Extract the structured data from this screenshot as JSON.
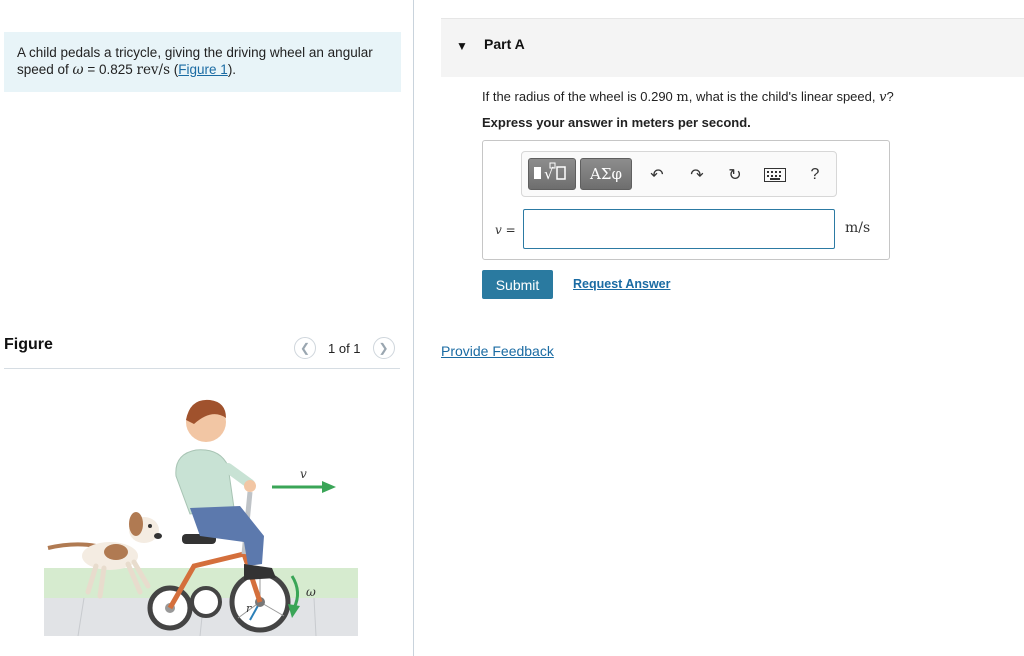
{
  "problem": {
    "text_before": "A child pedals a tricycle, giving the driving wheel an angular speed of ",
    "omega_symbol": "ω",
    "equals": " = 0.825 ",
    "unit": "rev/s",
    "paren_open": " (",
    "figure_link": "Figure 1",
    "paren_close": ")."
  },
  "figure": {
    "title": "Figure",
    "counter": "1 of 1",
    "prev_icon": "chevron-left-icon",
    "next_icon": "chevron-right-icon",
    "labels": {
      "velocity": "v",
      "omega": "ω",
      "radius": "r"
    }
  },
  "part": {
    "title": "Part A",
    "question_prefix": "If the radius of the wheel is 0.290 ",
    "question_unit": "m",
    "question_mid": ", what is the child's linear speed, ",
    "question_var": "v",
    "question_suffix": "?",
    "instruction": "Express your answer in meters per second."
  },
  "toolbar": {
    "templates_icon": "templates-icon",
    "symbols_label": "ΑΣφ",
    "undo_icon": "undo-icon",
    "redo_icon": "redo-icon",
    "reset_icon": "reset-icon",
    "keyboard_icon": "keyboard-icon",
    "help_label": "?"
  },
  "answer": {
    "label_var": "v",
    "label_eq": " =",
    "value": "",
    "units": "m/s"
  },
  "actions": {
    "submit": "Submit",
    "request_answer": "Request Answer",
    "feedback": "Provide Feedback"
  },
  "colors": {
    "accent": "#2a7aa0",
    "link": "#1a6ba3",
    "problem_bg": "#e8f4f8",
    "velocity_arrow": "#3aa557",
    "omega_arrow": "#3aa557"
  }
}
